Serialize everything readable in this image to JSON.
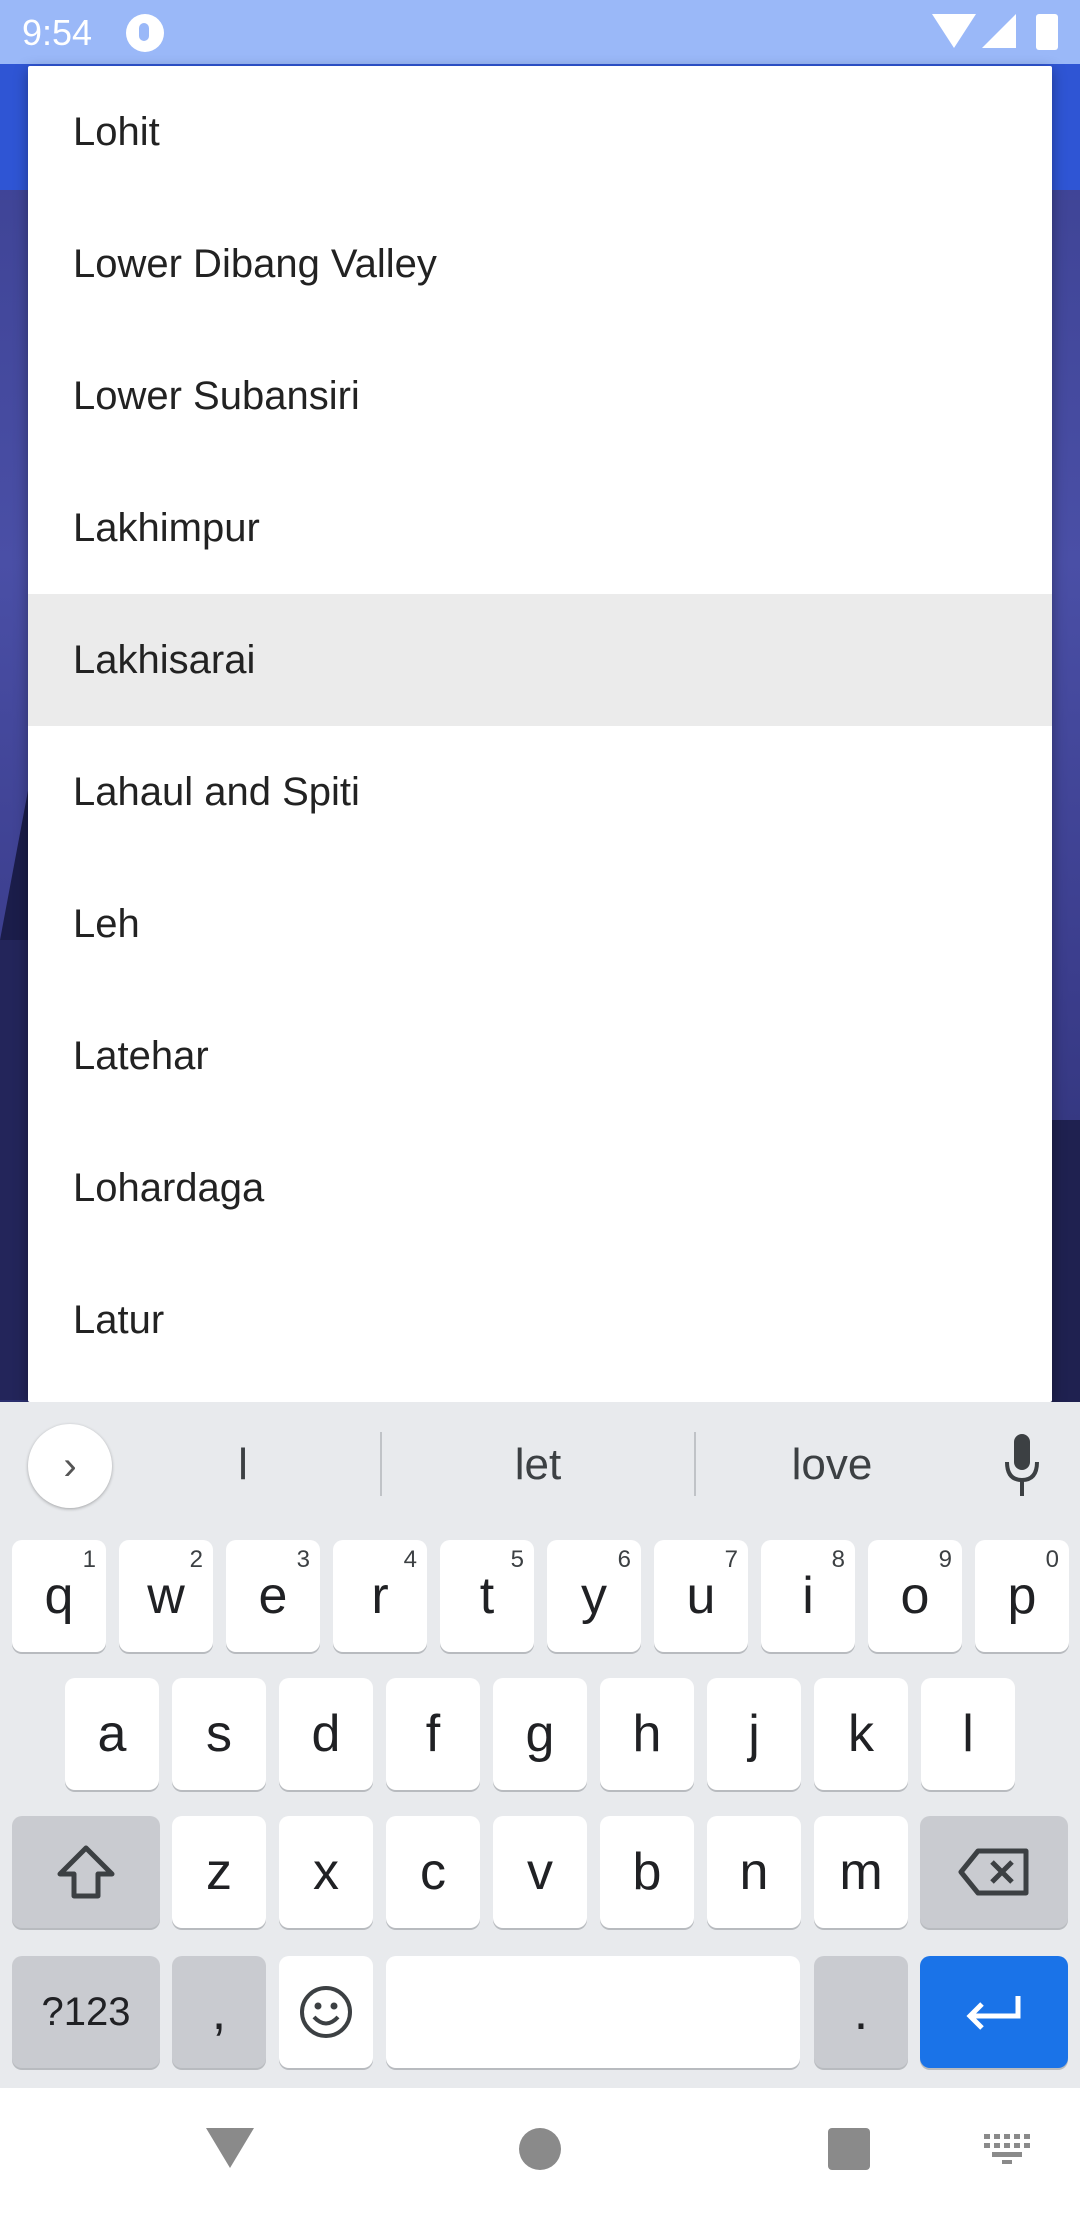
{
  "status_bar": {
    "time": "9:54"
  },
  "dropdown": {
    "items": [
      {
        "label": "Lohit"
      },
      {
        "label": "Lower Dibang Valley"
      },
      {
        "label": "Lower Subansiri"
      },
      {
        "label": "Lakhimpur"
      },
      {
        "label": "Lakhisarai",
        "selected": true
      },
      {
        "label": "Lahaul and Spiti"
      },
      {
        "label": "Leh"
      },
      {
        "label": "Latehar"
      },
      {
        "label": "Lohardaga"
      },
      {
        "label": "Latur"
      }
    ],
    "selected_color": "#ebebeb"
  },
  "keyboard": {
    "suggestions": [
      "l",
      "let",
      "love"
    ],
    "row1": [
      {
        "key": "q",
        "hint": "1"
      },
      {
        "key": "w",
        "hint": "2"
      },
      {
        "key": "e",
        "hint": "3"
      },
      {
        "key": "r",
        "hint": "4"
      },
      {
        "key": "t",
        "hint": "5"
      },
      {
        "key": "y",
        "hint": "6"
      },
      {
        "key": "u",
        "hint": "7"
      },
      {
        "key": "i",
        "hint": "8"
      },
      {
        "key": "o",
        "hint": "9"
      },
      {
        "key": "p",
        "hint": "0"
      }
    ],
    "row2": [
      "a",
      "s",
      "d",
      "f",
      "g",
      "h",
      "j",
      "k",
      "l"
    ],
    "row3": [
      "z",
      "x",
      "c",
      "v",
      "b",
      "n",
      "m"
    ],
    "symbols_label": "?123",
    "comma_label": ",",
    "period_label": ".",
    "enter_color": "#1a73e8"
  },
  "colors": {
    "status_bar": "#9ab8f8",
    "app_bar": "#2f55d4",
    "keyboard_bg": "#e8eaed"
  }
}
